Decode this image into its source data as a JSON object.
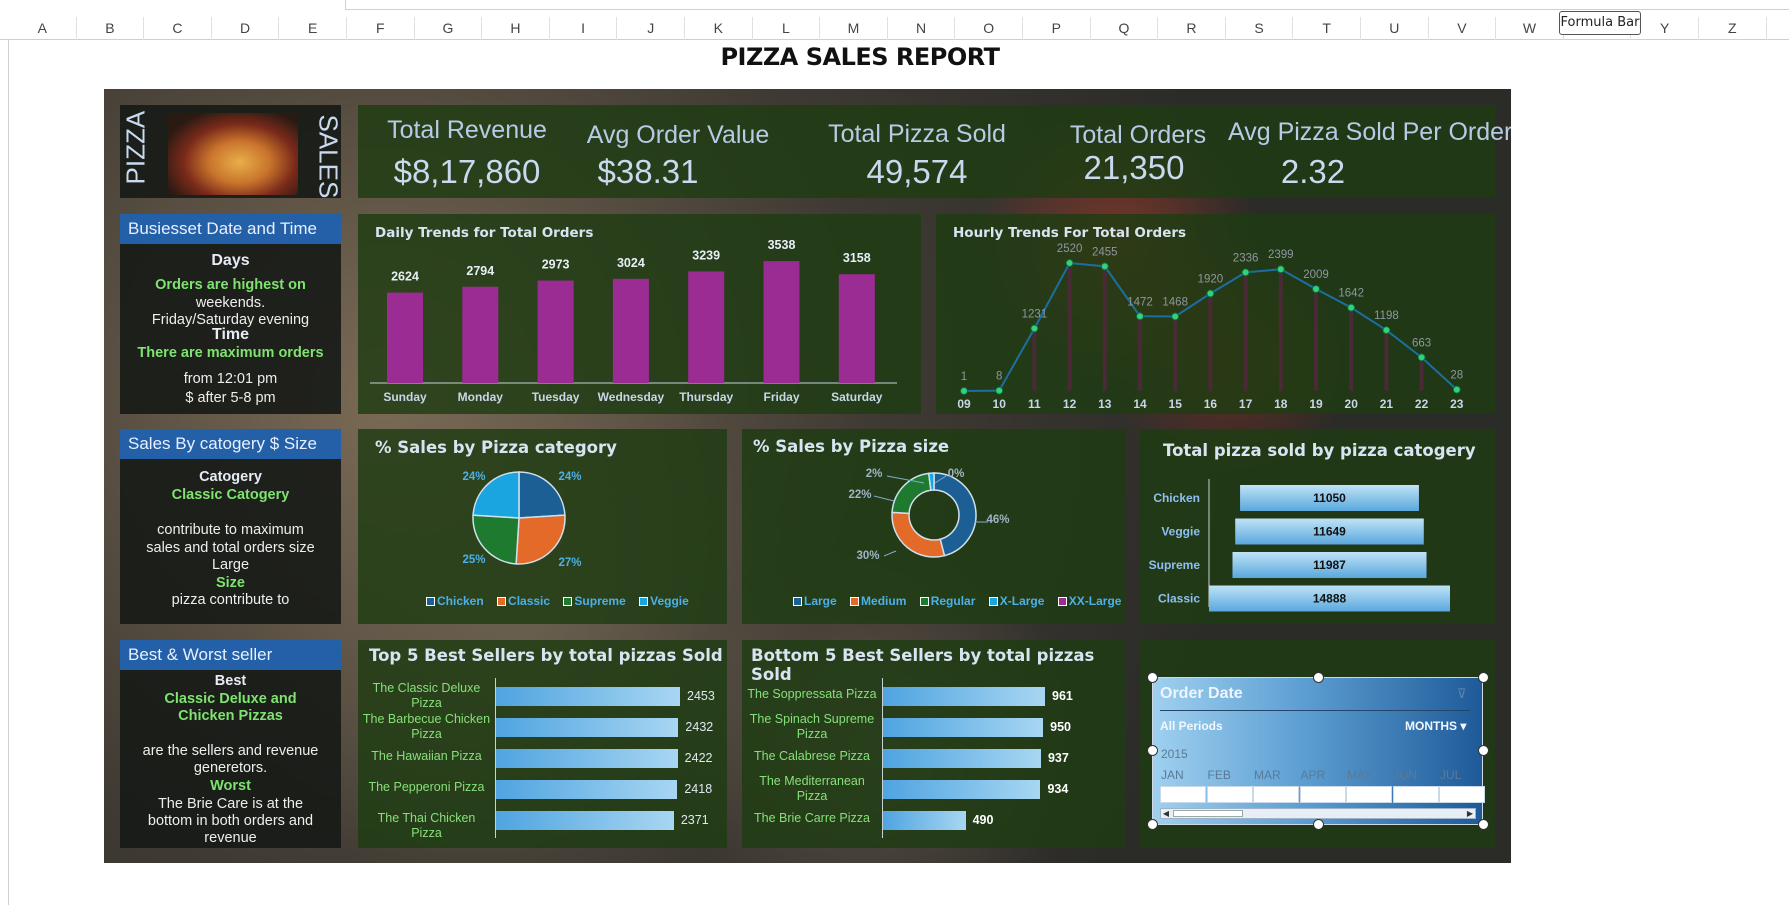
{
  "sheet": {
    "columns": [
      "A",
      "B",
      "C",
      "D",
      "E",
      "F",
      "G",
      "H",
      "I",
      "J",
      "K",
      "L",
      "M",
      "N",
      "O",
      "P",
      "Q",
      "R",
      "S",
      "T",
      "U",
      "V",
      "W",
      "X",
      "Y",
      "Z"
    ],
    "formula_tooltip": "Formula Bar"
  },
  "title": "PIZZA SALES REPORT",
  "logo": {
    "left_text": "PIZZA",
    "right_text": "SALES"
  },
  "kpis": [
    {
      "label": "Total Revenue",
      "value": "$8,17,860"
    },
    {
      "label": "Avg Order Value",
      "value": "$38.31"
    },
    {
      "label": "Total Pizza Sold",
      "value": "49,574"
    },
    {
      "label": "Total Orders",
      "value": "21,350"
    },
    {
      "label": "Avg Pizza Sold Per Order",
      "value": "2.32"
    }
  ],
  "busiest": {
    "header": "Busiesset Date and Time",
    "days_title": "Days",
    "days_line1": "Orders are highest on",
    "days_line2": "weekends.",
    "days_line3": "Friday/Saturday evening",
    "time_title": "Time",
    "time_line1": "There are maximum orders",
    "time_line2": "from  12:01 pm",
    "time_line3": "$ after 5-8 pm"
  },
  "sales_cat": {
    "header": "Sales By catogery $ Size",
    "l1": "Catogery",
    "l2": "Classic Catogery",
    "l3": "contribute to maximum",
    "l4": "sales and total orders size",
    "l5": "Large",
    "l6": "Size",
    "l7": "pizza contribute to"
  },
  "best_worst": {
    "header": "Best & Worst seller",
    "l1": "Best",
    "l2": "Classic Deluxe and",
    "l3": "Chicken Pizzas",
    "l4": "are the sellers and revenue",
    "l5": "generetors.",
    "l6": "Worst",
    "l7": "The Brie Care is at the",
    "l8": "bottom in both orders and",
    "l9": "revenue"
  },
  "chart_data": [
    {
      "id": "daily",
      "type": "bar",
      "title": "Daily Trends for Total Orders",
      "categories": [
        "Sunday",
        "Monday",
        "Tuesday",
        "Wednesday",
        "Thursday",
        "Friday",
        "Saturday"
      ],
      "values": [
        2624,
        2794,
        2973,
        3024,
        3239,
        3538,
        3158
      ],
      "color": "#9b2c93",
      "ylim": [
        0,
        3600
      ]
    },
    {
      "id": "hourly",
      "type": "line",
      "title": "Hourly Trends For Total Orders",
      "x": [
        "09",
        "10",
        "11",
        "12",
        "13",
        "14",
        "15",
        "16",
        "17",
        "18",
        "19",
        "20",
        "21",
        "22",
        "23"
      ],
      "values": [
        1,
        8,
        1231,
        2520,
        2455,
        1472,
        1468,
        1920,
        2336,
        2399,
        2009,
        1642,
        1198,
        663,
        28
      ],
      "color": "#1a6fa0",
      "ylim": [
        0,
        2800
      ]
    },
    {
      "id": "pie_category",
      "type": "pie",
      "title": "% Sales by Pizza category",
      "labels": [
        "Chicken",
        "Classic",
        "Supreme",
        "Veggie"
      ],
      "values": [
        24,
        27,
        25,
        24
      ],
      "value_labels": [
        "24%",
        "27%",
        "25%",
        "24%"
      ],
      "colors": [
        "#1c5f94",
        "#e46a2a",
        "#1e7a2e",
        "#1aa5e0"
      ]
    },
    {
      "id": "donut_size",
      "type": "pie",
      "title": "% Sales by Pizza size",
      "labels": [
        "Large",
        "Medium",
        "Regular",
        "X-Large",
        "XX-Large"
      ],
      "values": [
        46,
        30,
        22,
        2,
        0
      ],
      "value_labels": [
        "46%",
        "30%",
        "22%",
        "2%",
        "0%"
      ],
      "colors": [
        "#1c5f94",
        "#e46a2a",
        "#1e7a2e",
        "#1aa5e0",
        "#9b2c93"
      ]
    },
    {
      "id": "sold_by_category",
      "type": "bar",
      "title": "Total pizza sold by pizza catogery",
      "categories": [
        "Chicken",
        "Veggie",
        "Supreme",
        "Classic"
      ],
      "values": [
        11050,
        11649,
        11987,
        14888
      ]
    },
    {
      "id": "top5",
      "type": "bar",
      "title": "Top 5 Best Sellers by total pizzas Sold",
      "categories": [
        "The Classic Deluxe Pizza",
        "The Barbecue Chicken Pizza",
        "The Hawaiian Pizza",
        "The Pepperoni Pizza",
        "The Thai Chicken Pizza"
      ],
      "values": [
        2453,
        2432,
        2422,
        2418,
        2371
      ]
    },
    {
      "id": "bottom5",
      "type": "bar",
      "title": "Bottom 5 Best Sellers by total pizzas Sold",
      "categories": [
        "The Soppressata Pizza",
        "The Spinach Supreme Pizza",
        "The Calabrese Pizza",
        "The Mediterranean Pizza",
        "The Brie Carre Pizza"
      ],
      "values": [
        961,
        950,
        937,
        934,
        490
      ]
    }
  ],
  "slicer": {
    "title": "Order Date",
    "periods": "All Periods",
    "level": "MONTHS",
    "year": "2015",
    "months": [
      "JAN",
      "FEB",
      "MAR",
      "APR",
      "MAY",
      "JUN",
      "JUL"
    ]
  }
}
